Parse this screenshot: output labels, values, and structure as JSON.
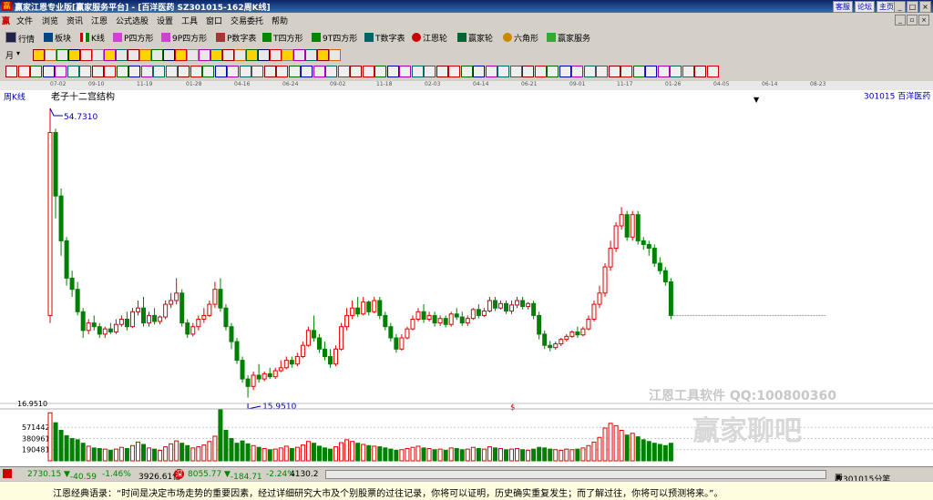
{
  "window": {
    "app_icon": "赢",
    "title": "赢家江恩专业版[赢家服务平台] - [百洋医药  SZ301015-162周K线]",
    "links": [
      "客服",
      "论坛",
      "主页"
    ]
  },
  "menu": [
    "文件",
    "浏览",
    "资讯",
    "江恩",
    "公式选股",
    "设置",
    "工具",
    "窗口",
    "交易委托",
    "帮助"
  ],
  "toolbar1": [
    "行情",
    "板块",
    "K线",
    "P四方形",
    "9P四方形",
    "P数字表",
    "T四方形",
    "9T四方形",
    "T数字表",
    "江恩轮",
    "赢家轮",
    "六角形",
    "赢家服务"
  ],
  "toolbar2": {
    "period": "月"
  },
  "date_strip": [
    "07-02",
    "09-10",
    "11-19",
    "01-28",
    "04-16",
    "06-24",
    "09-02",
    "11-18",
    "02-03",
    "04-14",
    "06-21",
    "09-01",
    "11-17",
    "01-26",
    "04-05",
    "06-14",
    "08-23"
  ],
  "chart": {
    "period_label": "周K线",
    "structure_label": "老子十二宫结构",
    "stock_label": "301015  百洋医药",
    "high_label": "54.7310",
    "low_label": "15.9510",
    "y_label_top": "16.9510",
    "vol_labels": [
      "571442",
      "380961",
      "190481"
    ],
    "dollar_mark": "$",
    "watermark_top": "江恩工具软件  QQ:100800360",
    "watermark_big": "赢家聊吧",
    "colors": {
      "up": "#e00000",
      "down": "#008000",
      "bg": "#ffffff"
    }
  },
  "chart_data": {
    "type": "candlestick",
    "y_range": [
      15.951,
      54.731
    ],
    "high": 54.731,
    "low": 15.951,
    "candles": [
      {
        "o": 27.0,
        "h": 54.7,
        "c": 51.5,
        "l": 26.0
      },
      {
        "o": 51.5,
        "h": 52.0,
        "c": 43.0,
        "l": 40.0
      },
      {
        "o": 43.0,
        "h": 44.0,
        "c": 37.0,
        "l": 35.0
      },
      {
        "o": 37.0,
        "h": 37.5,
        "c": 32.0,
        "l": 31.0
      },
      {
        "o": 32.0,
        "h": 33.0,
        "c": 30.5,
        "l": 29.5
      },
      {
        "o": 30.5,
        "h": 31.5,
        "c": 27.5,
        "l": 27.0
      },
      {
        "o": 27.5,
        "h": 28.0,
        "c": 25.0,
        "l": 24.0
      },
      {
        "o": 25.0,
        "h": 26.5,
        "c": 26.0,
        "l": 24.5
      },
      {
        "o": 26.0,
        "h": 27.0,
        "c": 25.5,
        "l": 25.0
      },
      {
        "o": 25.5,
        "h": 26.0,
        "c": 24.5,
        "l": 24.0
      },
      {
        "o": 24.5,
        "h": 25.5,
        "c": 25.2,
        "l": 24.0
      },
      {
        "o": 25.2,
        "h": 26.0,
        "c": 24.8,
        "l": 24.5
      },
      {
        "o": 24.8,
        "h": 26.5,
        "c": 25.8,
        "l": 24.5
      },
      {
        "o": 25.8,
        "h": 27.0,
        "c": 26.5,
        "l": 25.5
      },
      {
        "o": 26.5,
        "h": 27.5,
        "c": 25.5,
        "l": 25.0
      },
      {
        "o": 25.5,
        "h": 28.0,
        "c": 27.5,
        "l": 25.3
      },
      {
        "o": 27.5,
        "h": 29.0,
        "c": 28.0,
        "l": 27.0
      },
      {
        "o": 28.0,
        "h": 29.5,
        "c": 26.0,
        "l": 25.5
      },
      {
        "o": 26.0,
        "h": 27.5,
        "c": 27.0,
        "l": 25.5
      },
      {
        "o": 27.0,
        "h": 28.0,
        "c": 26.2,
        "l": 25.8
      },
      {
        "o": 26.2,
        "h": 27.0,
        "c": 26.8,
        "l": 25.8
      },
      {
        "o": 26.8,
        "h": 29.0,
        "c": 28.5,
        "l": 26.5
      },
      {
        "o": 28.5,
        "h": 30.0,
        "c": 29.0,
        "l": 28.0
      },
      {
        "o": 29.0,
        "h": 32.0,
        "c": 30.0,
        "l": 28.5
      },
      {
        "o": 30.0,
        "h": 30.5,
        "c": 26.0,
        "l": 25.5
      },
      {
        "o": 26.0,
        "h": 26.5,
        "c": 24.5,
        "l": 24.0
      },
      {
        "o": 24.5,
        "h": 26.0,
        "c": 25.5,
        "l": 24.2
      },
      {
        "o": 25.5,
        "h": 27.0,
        "c": 26.5,
        "l": 25.0
      },
      {
        "o": 26.5,
        "h": 28.0,
        "c": 27.0,
        "l": 26.0
      },
      {
        "o": 27.0,
        "h": 29.0,
        "c": 28.5,
        "l": 26.8
      },
      {
        "o": 28.5,
        "h": 31.5,
        "c": 30.5,
        "l": 28.0
      },
      {
        "o": 30.5,
        "h": 32.0,
        "c": 28.0,
        "l": 27.5
      },
      {
        "o": 28.0,
        "h": 28.5,
        "c": 25.5,
        "l": 25.0
      },
      {
        "o": 25.5,
        "h": 26.0,
        "c": 23.5,
        "l": 22.5
      },
      {
        "o": 23.5,
        "h": 24.0,
        "c": 21.0,
        "l": 20.5
      },
      {
        "o": 21.0,
        "h": 21.5,
        "c": 18.5,
        "l": 18.0
      },
      {
        "o": 18.5,
        "h": 19.0,
        "c": 17.5,
        "l": 16.0
      },
      {
        "o": 17.5,
        "h": 19.5,
        "c": 19.0,
        "l": 17.0
      },
      {
        "o": 19.0,
        "h": 20.5,
        "c": 18.5,
        "l": 18.0
      },
      {
        "o": 18.5,
        "h": 19.5,
        "c": 19.2,
        "l": 18.2
      },
      {
        "o": 19.2,
        "h": 20.0,
        "c": 18.8,
        "l": 18.5
      },
      {
        "o": 18.8,
        "h": 20.0,
        "c": 19.6,
        "l": 18.5
      },
      {
        "o": 19.6,
        "h": 21.0,
        "c": 20.0,
        "l": 19.4
      },
      {
        "o": 20.0,
        "h": 21.5,
        "c": 21.0,
        "l": 19.8
      },
      {
        "o": 21.0,
        "h": 21.5,
        "c": 20.5,
        "l": 20.0
      },
      {
        "o": 20.5,
        "h": 22.0,
        "c": 21.5,
        "l": 20.2
      },
      {
        "o": 21.5,
        "h": 23.5,
        "c": 23.0,
        "l": 21.3
      },
      {
        "o": 23.0,
        "h": 25.5,
        "c": 25.0,
        "l": 22.8
      },
      {
        "o": 25.0,
        "h": 27.0,
        "c": 24.0,
        "l": 23.5
      },
      {
        "o": 24.0,
        "h": 24.5,
        "c": 22.5,
        "l": 22.0
      },
      {
        "o": 22.5,
        "h": 23.5,
        "c": 21.5,
        "l": 21.0
      },
      {
        "o": 21.5,
        "h": 22.5,
        "c": 20.5,
        "l": 20.0
      },
      {
        "o": 20.5,
        "h": 23.0,
        "c": 22.5,
        "l": 20.2
      },
      {
        "o": 22.5,
        "h": 26.0,
        "c": 25.5,
        "l": 22.3
      },
      {
        "o": 25.5,
        "h": 28.0,
        "c": 27.0,
        "l": 25.0
      },
      {
        "o": 27.0,
        "h": 29.0,
        "c": 28.0,
        "l": 26.5
      },
      {
        "o": 28.0,
        "h": 29.5,
        "c": 27.2,
        "l": 26.8
      },
      {
        "o": 27.2,
        "h": 29.5,
        "c": 28.8,
        "l": 27.0
      },
      {
        "o": 28.8,
        "h": 29.0,
        "c": 27.5,
        "l": 27.0
      },
      {
        "o": 27.5,
        "h": 29.5,
        "c": 29.0,
        "l": 27.3
      },
      {
        "o": 29.0,
        "h": 29.5,
        "c": 27.0,
        "l": 26.5
      },
      {
        "o": 27.0,
        "h": 27.5,
        "c": 25.5,
        "l": 25.0
      },
      {
        "o": 25.5,
        "h": 26.0,
        "c": 24.0,
        "l": 23.5
      },
      {
        "o": 24.0,
        "h": 24.5,
        "c": 22.5,
        "l": 22.0
      },
      {
        "o": 22.5,
        "h": 24.5,
        "c": 24.0,
        "l": 22.3
      },
      {
        "o": 24.0,
        "h": 25.5,
        "c": 25.2,
        "l": 23.8
      },
      {
        "o": 25.2,
        "h": 27.0,
        "c": 26.5,
        "l": 25.0
      },
      {
        "o": 26.5,
        "h": 28.0,
        "c": 27.5,
        "l": 26.2
      },
      {
        "o": 27.5,
        "h": 28.5,
        "c": 26.5,
        "l": 26.0
      },
      {
        "o": 26.5,
        "h": 27.5,
        "c": 27.0,
        "l": 26.2
      },
      {
        "o": 27.0,
        "h": 27.5,
        "c": 26.0,
        "l": 25.5
      },
      {
        "o": 26.0,
        "h": 27.0,
        "c": 26.6,
        "l": 25.6
      },
      {
        "o": 26.6,
        "h": 27.0,
        "c": 25.8,
        "l": 25.4
      },
      {
        "o": 25.8,
        "h": 27.5,
        "c": 27.2,
        "l": 25.5
      },
      {
        "o": 27.2,
        "h": 28.0,
        "c": 26.8,
        "l": 26.4
      },
      {
        "o": 26.8,
        "h": 27.5,
        "c": 26.0,
        "l": 25.6
      },
      {
        "o": 26.0,
        "h": 27.0,
        "c": 26.6,
        "l": 25.6
      },
      {
        "o": 26.6,
        "h": 28.0,
        "c": 27.8,
        "l": 26.4
      },
      {
        "o": 27.8,
        "h": 28.5,
        "c": 27.0,
        "l": 26.6
      },
      {
        "o": 27.0,
        "h": 28.0,
        "c": 27.6,
        "l": 26.8
      },
      {
        "o": 27.6,
        "h": 29.5,
        "c": 29.0,
        "l": 27.4
      },
      {
        "o": 29.0,
        "h": 29.5,
        "c": 28.0,
        "l": 27.6
      },
      {
        "o": 28.0,
        "h": 29.0,
        "c": 28.6,
        "l": 27.8
      },
      {
        "o": 28.6,
        "h": 29.0,
        "c": 27.6,
        "l": 27.2
      },
      {
        "o": 27.6,
        "h": 29.0,
        "c": 28.4,
        "l": 27.2
      },
      {
        "o": 28.4,
        "h": 29.5,
        "c": 29.0,
        "l": 28.0
      },
      {
        "o": 29.0,
        "h": 29.5,
        "c": 28.2,
        "l": 27.8
      },
      {
        "o": 28.2,
        "h": 28.8,
        "c": 28.6,
        "l": 27.8
      },
      {
        "o": 28.6,
        "h": 29.0,
        "c": 27.0,
        "l": 26.5
      },
      {
        "o": 27.0,
        "h": 27.5,
        "c": 24.5,
        "l": 23.8
      },
      {
        "o": 24.5,
        "h": 25.0,
        "c": 23.0,
        "l": 22.5
      },
      {
        "o": 23.0,
        "h": 23.6,
        "c": 22.7,
        "l": 22.2
      },
      {
        "o": 22.7,
        "h": 23.5,
        "c": 23.2,
        "l": 22.4
      },
      {
        "o": 23.2,
        "h": 24.0,
        "c": 23.8,
        "l": 22.9
      },
      {
        "o": 23.8,
        "h": 24.5,
        "c": 24.2,
        "l": 23.5
      },
      {
        "o": 24.2,
        "h": 25.0,
        "c": 24.8,
        "l": 24.0
      },
      {
        "o": 24.8,
        "h": 25.5,
        "c": 24.4,
        "l": 24.0
      },
      {
        "o": 24.4,
        "h": 25.5,
        "c": 25.2,
        "l": 24.2
      },
      {
        "o": 25.2,
        "h": 27.0,
        "c": 26.5,
        "l": 25.0
      },
      {
        "o": 26.5,
        "h": 29.0,
        "c": 28.5,
        "l": 26.2
      },
      {
        "o": 28.5,
        "h": 31.0,
        "c": 30.0,
        "l": 28.0
      },
      {
        "o": 30.0,
        "h": 34.0,
        "c": 33.5,
        "l": 29.5
      },
      {
        "o": 33.5,
        "h": 37.0,
        "c": 36.0,
        "l": 33.0
      },
      {
        "o": 36.0,
        "h": 39.5,
        "c": 39.0,
        "l": 35.5
      },
      {
        "o": 39.0,
        "h": 41.5,
        "c": 40.5,
        "l": 38.5
      },
      {
        "o": 40.5,
        "h": 41.0,
        "c": 37.5,
        "l": 37.0
      },
      {
        "o": 37.5,
        "h": 41.0,
        "c": 40.5,
        "l": 37.0
      },
      {
        "o": 40.5,
        "h": 41.0,
        "c": 37.0,
        "l": 36.5
      },
      {
        "o": 37.0,
        "h": 37.5,
        "c": 36.5,
        "l": 35.8
      },
      {
        "o": 36.5,
        "h": 37.0,
        "c": 36.0,
        "l": 35.0
      },
      {
        "o": 36.0,
        "h": 36.5,
        "c": 34.0,
        "l": 33.5
      },
      {
        "o": 34.0,
        "h": 34.8,
        "c": 33.0,
        "l": 32.5
      },
      {
        "o": 33.0,
        "h": 33.5,
        "c": 31.5,
        "l": 31.0
      },
      {
        "o": 31.5,
        "h": 32.0,
        "c": 27.0,
        "l": 26.5
      }
    ],
    "last_close": 27.0,
    "volume_scale": [
      190481,
      380961,
      571442
    ],
    "volume": [
      820000,
      650000,
      520000,
      430000,
      380000,
      360000,
      300000,
      250000,
      220000,
      210000,
      200000,
      180000,
      200000,
      230000,
      210000,
      260000,
      320000,
      280000,
      220000,
      200000,
      180000,
      240000,
      290000,
      340000,
      300000,
      260000,
      220000,
      240000,
      270000,
      330000,
      420000,
      870000,
      520000,
      380000,
      300000,
      340000,
      290000,
      260000,
      230000,
      210000,
      190000,
      200000,
      220000,
      250000,
      210000,
      230000,
      270000,
      330000,
      300000,
      250000,
      220000,
      200000,
      240000,
      310000,
      360000,
      330000,
      300000,
      280000,
      260000,
      250000,
      240000,
      220000,
      200000,
      180000,
      190000,
      210000,
      230000,
      250000,
      220000,
      210000,
      190000,
      200000,
      180000,
      220000,
      210000,
      190000,
      200000,
      230000,
      210000,
      200000,
      240000,
      220000,
      210000,
      190000,
      200000,
      210000,
      190000,
      180000,
      200000,
      230000,
      220000,
      200000,
      190000,
      180000,
      200000,
      190000,
      200000,
      220000,
      260000,
      320000,
      400000,
      560000,
      640000,
      600000,
      520000,
      440000,
      470000,
      410000,
      360000,
      330000,
      300000,
      280000,
      260000,
      300000
    ]
  },
  "statusbar": {
    "sh_index": "2730.15",
    "sh_change": "-40.59",
    "sh_pct": "-1.46%",
    "sh_amount": "3926.61亿",
    "sz_badge": "深",
    "sz_index": "8055.77",
    "sz_change": "-184.71",
    "sz_pct": "-2.24%",
    "sz_amount": "4130.2",
    "right": "收301015分笔"
  },
  "quote": "江恩经典语录：“时间是决定市场走势的重要因素，经过详细研究大市及个别股票的过往记录，你将可以证明，历史确实重复发生；而了解过往，你将可以预测将来。”。"
}
